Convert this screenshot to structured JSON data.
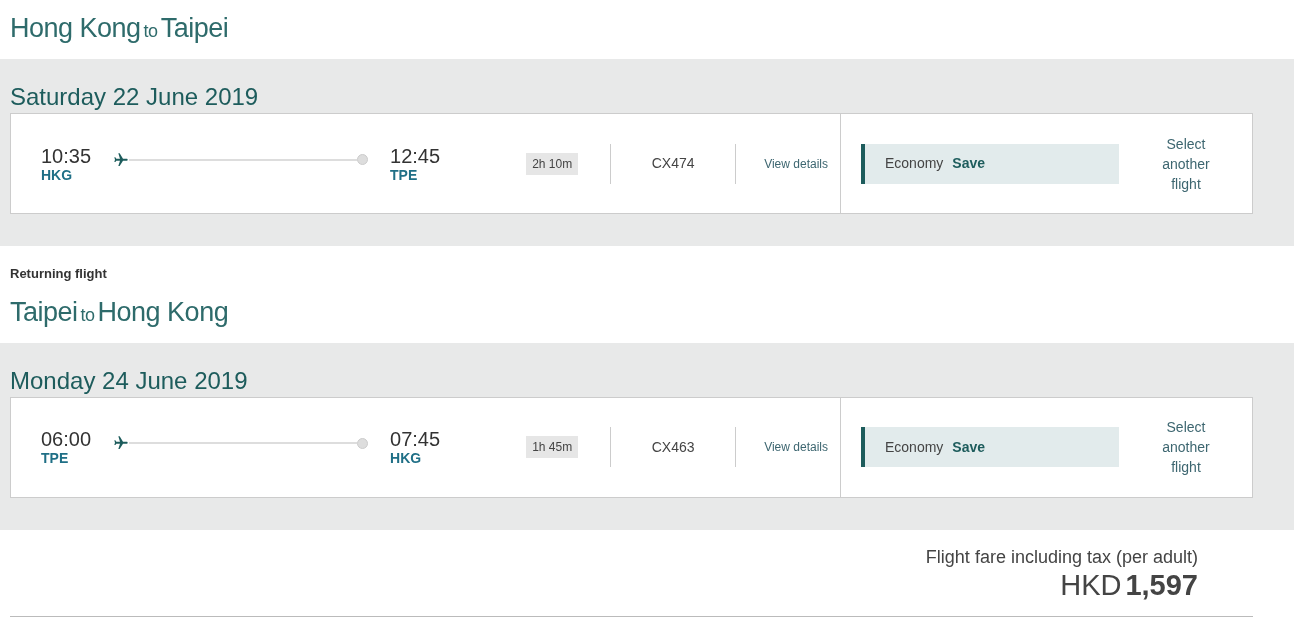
{
  "journeys": [
    {
      "origin": "Hong Kong",
      "connector": "to",
      "destination": "Taipei",
      "date": "Saturday 22 June 2019",
      "departure_time": "10:35",
      "departure_code": "HKG",
      "arrival_time": "12:45",
      "arrival_code": "TPE",
      "duration": "2h 10m",
      "flight_number": "CX474",
      "details_link": "View details",
      "cabin": "Economy",
      "fare_type": "Save",
      "change_link": "Select another flight"
    },
    {
      "label": "Returning flight",
      "origin": "Taipei",
      "connector": "to",
      "destination": "Hong Kong",
      "date": "Monday 24 June 2019",
      "departure_time": "06:00",
      "departure_code": "TPE",
      "arrival_time": "07:45",
      "arrival_code": "HKG",
      "duration": "1h 45m",
      "flight_number": "CX463",
      "details_link": "View details",
      "cabin": "Economy",
      "fare_type": "Save",
      "change_link": "Select another flight"
    }
  ],
  "total": {
    "label": "Flight fare including tax (per adult)",
    "currency": "HKD",
    "amount": "1,597"
  }
}
